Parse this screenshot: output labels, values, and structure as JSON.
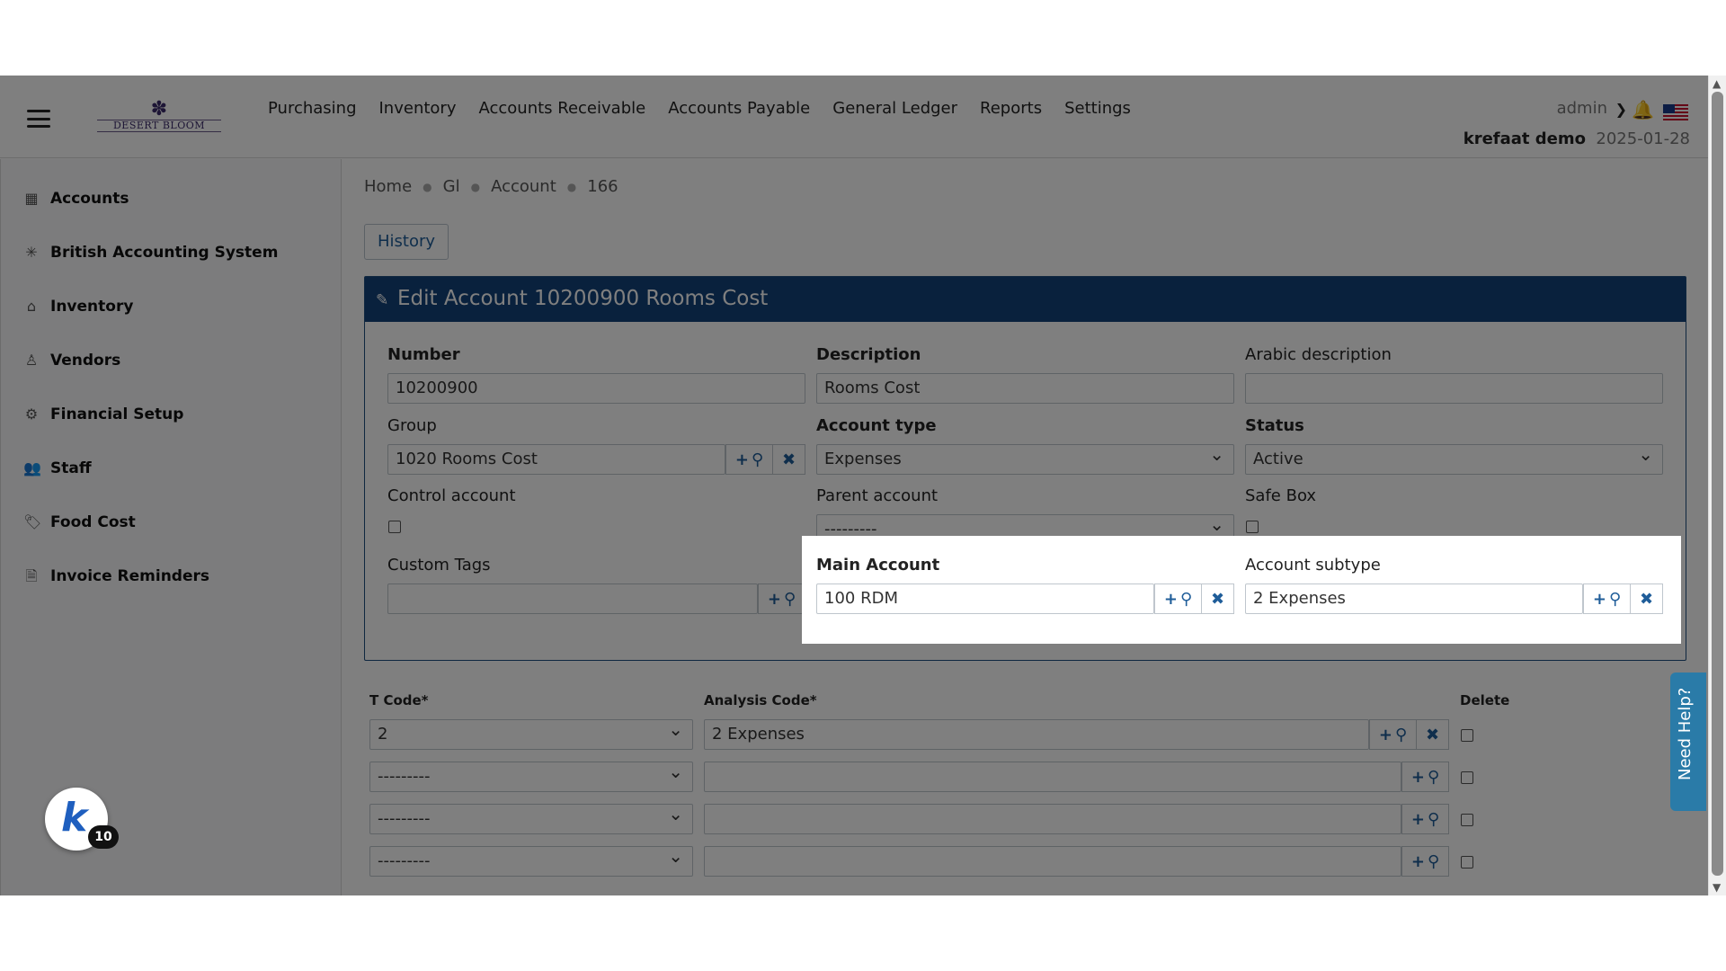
{
  "topnav": {
    "logo_text": "DESERT BLOOM",
    "menu": [
      "Purchasing",
      "Inventory",
      "Accounts Receivable",
      "Accounts Payable",
      "General Ledger",
      "Reports",
      "Settings"
    ],
    "user": "admin",
    "company": "krefaat demo",
    "date": "2025-01-28"
  },
  "sidebar": {
    "items": [
      {
        "label": "Accounts",
        "icon": "calculator-icon"
      },
      {
        "label": "British Accounting System",
        "icon": "union-jack-icon"
      },
      {
        "label": "Inventory",
        "icon": "warehouse-icon"
      },
      {
        "label": "Vendors",
        "icon": "person-icon"
      },
      {
        "label": "Financial Setup",
        "icon": "gear-icon"
      },
      {
        "label": "Staff",
        "icon": "users-icon"
      },
      {
        "label": "Food Cost",
        "icon": "tag-icon"
      },
      {
        "label": "Invoice Reminders",
        "icon": "document-icon"
      }
    ]
  },
  "breadcrumb": [
    "Home",
    "Gl",
    "Account",
    "166"
  ],
  "history_label": "History",
  "panel_title": "Edit Account 10200900 Rooms Cost",
  "form": {
    "number_label": "Number",
    "number_value": "10200900",
    "description_label": "Description",
    "description_value": "Rooms Cost",
    "arabic_label": "Arabic description",
    "arabic_value": "",
    "group_label": "Group",
    "group_value": "1020 Rooms Cost",
    "account_type_label": "Account type",
    "account_type_value": "Expenses",
    "status_label": "Status",
    "status_value": "Active",
    "control_label": "Control account",
    "parent_label": "Parent account",
    "parent_value": "---------",
    "safebox_label": "Safe Box",
    "custom_tags_label": "Custom Tags",
    "main_account_label": "Main Account",
    "main_account_value": "100 RDM",
    "subtype_label": "Account subtype",
    "subtype_value": "2 Expenses"
  },
  "codes_table": {
    "headers": [
      "T Code*",
      "Analysis Code*",
      "Delete"
    ],
    "rows": [
      {
        "t_code": "2",
        "analysis": "2 Expenses"
      },
      {
        "t_code": "---------",
        "analysis": ""
      },
      {
        "t_code": "---------",
        "analysis": ""
      },
      {
        "t_code": "---------",
        "analysis": ""
      }
    ]
  },
  "need_help": "Need Help?",
  "badge_count": "10",
  "colors": {
    "header": "#12427a",
    "link": "#1f5d99",
    "help": "#2a7ba8"
  }
}
